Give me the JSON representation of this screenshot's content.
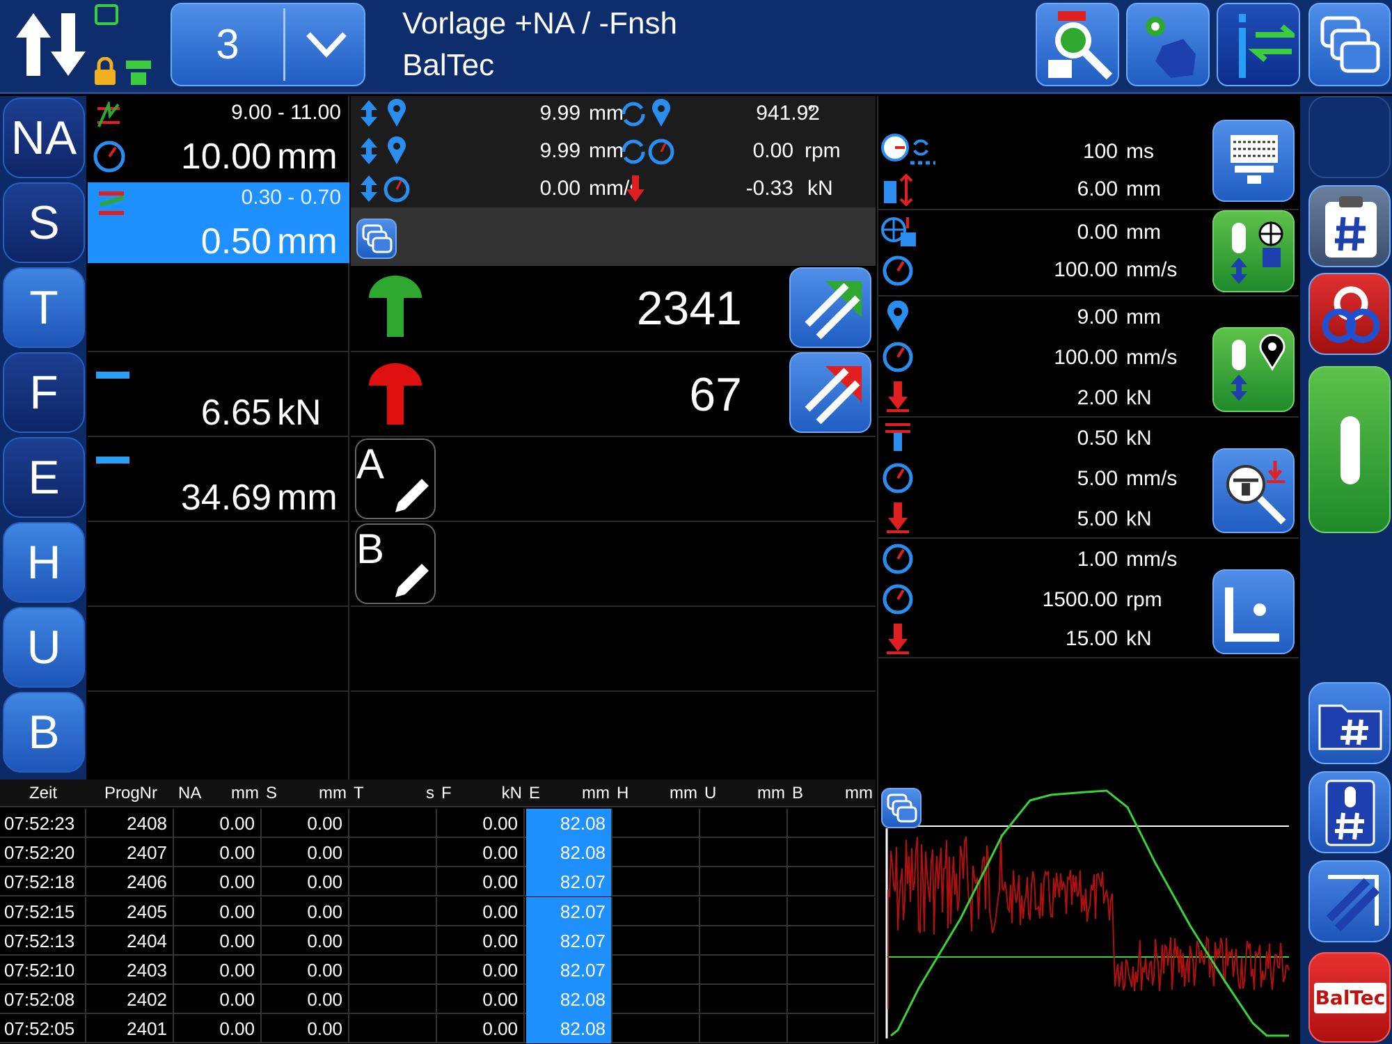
{
  "header": {
    "program_number": "3",
    "title": "Vorlage +NA / -Fnsh",
    "subtitle": "BalTec"
  },
  "nav": [
    "NA",
    "S",
    "T",
    "F",
    "E",
    "H",
    "U",
    "B"
  ],
  "left_panel": {
    "na_range": "9.00 - 11.00",
    "na_value": "10.00",
    "na_unit": "mm",
    "s_range": "0.30 - 0.70",
    "s_value": "0.50",
    "s_unit": "mm",
    "f_value": "6.65",
    "f_unit": "kN",
    "e_value": "34.69",
    "e_unit": "mm"
  },
  "status": {
    "pos1": "9.99",
    "pos1_unit": "mm",
    "pos2": "9.99",
    "pos2_unit": "mm",
    "speed": "0.00",
    "speed_unit": "mm/s",
    "angle": "941.92",
    "angle_unit": "°",
    "rpm": "0.00",
    "rpm_unit": "rpm",
    "force": "-0.33",
    "force_unit": "kN"
  },
  "counters": {
    "good": "2341",
    "bad": "67"
  },
  "notes": {
    "a_label": "A",
    "b_label": "B"
  },
  "params": {
    "p1_time": "100",
    "p1_time_unit": "ms",
    "p1_dist": "6.00",
    "p1_dist_unit": "mm",
    "p2_dist": "0.00",
    "p2_dist_unit": "mm",
    "p2_speed": "100.00",
    "p2_speed_unit": "mm/s",
    "p3_pos": "9.00",
    "p3_pos_unit": "mm",
    "p3_speed": "100.00",
    "p3_speed_unit": "mm/s",
    "p3_force": "2.00",
    "p3_force_unit": "kN",
    "p4_force": "0.50",
    "p4_force_unit": "kN",
    "p4_speed": "5.00",
    "p4_speed_unit": "mm/s",
    "p4_force2": "5.00",
    "p4_force2_unit": "kN",
    "p5_speed": "1.00",
    "p5_speed_unit": "mm/s",
    "p5_rpm": "1500.00",
    "p5_rpm_unit": "rpm",
    "p5_force": "15.00",
    "p5_force_unit": "kN"
  },
  "table": {
    "headers": [
      {
        "name": "Zeit",
        "unit": ""
      },
      {
        "name": "ProgNr",
        "unit": ""
      },
      {
        "name": "NA",
        "unit": "mm"
      },
      {
        "name": "S",
        "unit": "mm"
      },
      {
        "name": "T",
        "unit": "s"
      },
      {
        "name": "F",
        "unit": "kN"
      },
      {
        "name": "E",
        "unit": "mm"
      },
      {
        "name": "H",
        "unit": "mm"
      },
      {
        "name": "U",
        "unit": "mm"
      },
      {
        "name": "B",
        "unit": "mm"
      }
    ],
    "rows": [
      [
        "07:52:23",
        "2408",
        "0.00",
        "0.00",
        "",
        "0.00",
        "82.08",
        "",
        "",
        ""
      ],
      [
        "07:52:20",
        "2407",
        "0.00",
        "0.00",
        "",
        "0.00",
        "82.08",
        "",
        "",
        ""
      ],
      [
        "07:52:18",
        "2406",
        "0.00",
        "0.00",
        "",
        "0.00",
        "82.07",
        "",
        "",
        ""
      ],
      [
        "07:52:15",
        "2405",
        "0.00",
        "0.00",
        "",
        "0.00",
        "82.07",
        "",
        "",
        ""
      ],
      [
        "07:52:13",
        "2404",
        "0.00",
        "0.00",
        "",
        "0.00",
        "82.07",
        "",
        "",
        ""
      ],
      [
        "07:52:10",
        "2403",
        "0.00",
        "0.00",
        "",
        "0.00",
        "82.07",
        "",
        "",
        ""
      ],
      [
        "07:52:08",
        "2402",
        "0.00",
        "0.00",
        "",
        "0.00",
        "82.08",
        "",
        "",
        ""
      ],
      [
        "07:52:05",
        "2401",
        "0.00",
        "0.00",
        "",
        "0.00",
        "82.08",
        "",
        "",
        ""
      ]
    ]
  },
  "brand_logo": "BalTec",
  "colors": {
    "header_bg": "#0d2d6c",
    "accent_blue": "#1e90ff",
    "good_green": "#2ea82e",
    "bad_red": "#e01010",
    "trace_green": "#39d439",
    "trace_red": "#b01010"
  }
}
